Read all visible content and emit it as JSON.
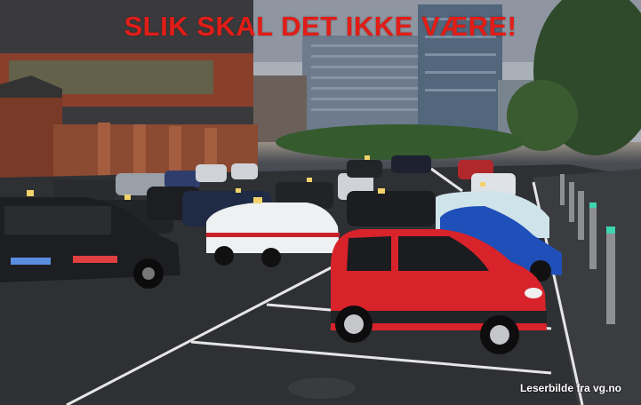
{
  "headline": "SLIK SKAL DET IKKE VÆRE!",
  "credit": "Leserbilde fra vg.no",
  "colors": {
    "headline": "#e11d17",
    "credit": "#ffffff",
    "sky": "#aab0b8",
    "asphalt": "#2e3034",
    "red_car": "#d8232b",
    "blue_car": "#1f4fb8",
    "brick": "#8a3f2b",
    "trees": "#2f4a2a"
  },
  "scene": {
    "subject": "parking lot crowded with taxis and a small red electric car",
    "icons": [
      "red-car",
      "blue-car",
      "white-taxi",
      "black-van",
      "brick-building",
      "glass-office-building",
      "trees",
      "bollards",
      "parking-lines"
    ]
  }
}
